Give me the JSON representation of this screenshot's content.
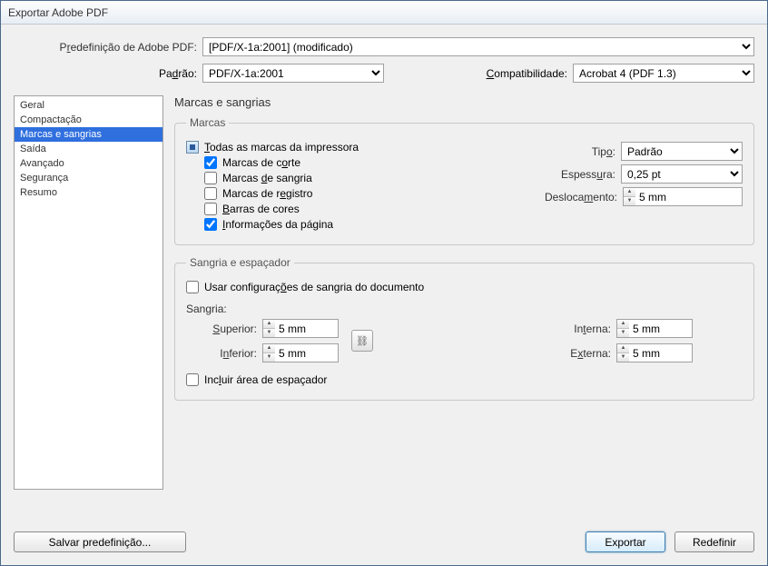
{
  "window": {
    "title": "Exportar Adobe PDF"
  },
  "preset": {
    "label_pre": "P",
    "label_key": "r",
    "label_post": "edefinição de Adobe PDF:",
    "value": "[PDF/X-1a:2001] (modificado)"
  },
  "standard": {
    "label_pre": "Pa",
    "label_key": "d",
    "label_post": "rão:",
    "value": "PDF/X-1a:2001"
  },
  "compat": {
    "label_pre": "",
    "label_key": "C",
    "label_post": "ompatibilidade:",
    "value": "Acrobat 4 (PDF 1.3)"
  },
  "sidebar": {
    "items": [
      {
        "label": "Geral"
      },
      {
        "label": "Compactação"
      },
      {
        "label": "Marcas e sangrias"
      },
      {
        "label": "Saída"
      },
      {
        "label": "Avançado"
      },
      {
        "label": "Segurança"
      },
      {
        "label": "Resumo"
      }
    ],
    "selected_index": 2
  },
  "section_title": "Marcas e sangrias",
  "marks": {
    "legend": "Marcas",
    "all": {
      "pre": "",
      "key": "T",
      "post": "odas as marcas da impressora"
    },
    "crop": {
      "pre": "Marcas de c",
      "key": "o",
      "post": "rte",
      "checked": true
    },
    "bleed": {
      "pre": "Marcas ",
      "key": "d",
      "post": "e sangria",
      "checked": false
    },
    "reg": {
      "pre": "Marcas de r",
      "key": "e",
      "post": "gistro",
      "checked": false
    },
    "bars": {
      "pre": "",
      "key": "B",
      "post": "arras de cores",
      "checked": false
    },
    "page": {
      "pre": "",
      "key": "I",
      "post": "nformações da página",
      "checked": true
    },
    "type": {
      "label_pre": "Tip",
      "label_key": "o",
      "label_post": ":",
      "value": "Padrão"
    },
    "weight": {
      "label_pre": "Espess",
      "label_key": "u",
      "label_post": "ra:",
      "value": "0,25 pt"
    },
    "offset": {
      "label_pre": "Desloca",
      "label_key": "m",
      "label_post": "ento:",
      "value": "5 mm"
    }
  },
  "bleed": {
    "legend": "Sangria e espaçador",
    "use_doc": {
      "pre": "Usar configuraç",
      "key": "õ",
      "post": "es de sangria do documento",
      "checked": false
    },
    "subheading": "Sangria:",
    "top": {
      "label_pre": "",
      "label_key": "S",
      "label_post": "uperior:",
      "value": "5 mm"
    },
    "bottom": {
      "label_pre": "I",
      "label_key": "n",
      "label_post": "ferior:",
      "value": "5 mm"
    },
    "inside": {
      "label_pre": "In",
      "label_key": "t",
      "label_post": "erna:",
      "value": "5 mm"
    },
    "outside": {
      "label_pre": "E",
      "label_key": "x",
      "label_post": "terna:",
      "value": "5 mm"
    },
    "link_icon": "⛓",
    "slug": {
      "pre": "Inc",
      "key": "l",
      "post": "uir área de espaçador",
      "checked": false
    }
  },
  "buttons": {
    "save": "Salvar predefinição...",
    "export": "Exportar",
    "reset": "Redefinir"
  }
}
